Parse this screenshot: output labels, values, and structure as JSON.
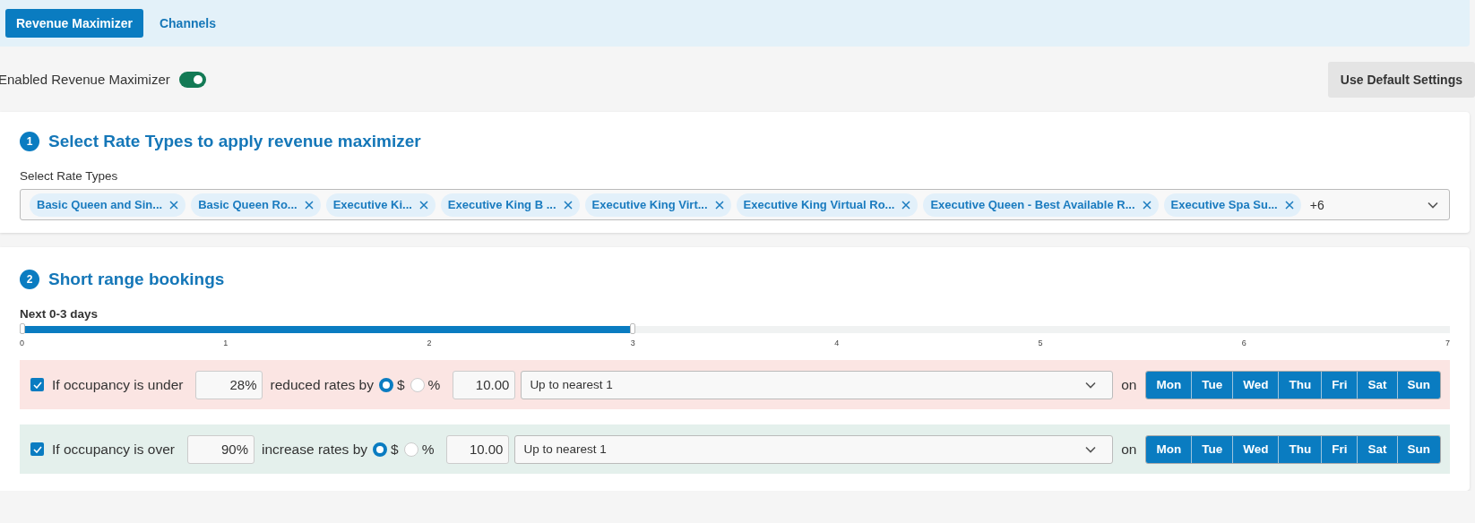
{
  "tabs": [
    {
      "label": "Revenue Maximizer",
      "selected": true
    },
    {
      "label": "Channels",
      "selected": false
    }
  ],
  "enable_toggle": {
    "label": "Enabled Revenue Maximizer",
    "on": true
  },
  "default_button": "Use Default Settings",
  "rate_types": {
    "step": "1",
    "title": "Select Rate Types to apply revenue maximizer",
    "field_label": "Select Rate Types",
    "chips": [
      "Basic Queen and Sin...",
      "Basic Queen Ro...",
      "Executive Ki...",
      "Executive King B ...",
      "Executive King Virt...",
      "Executive King Virtual Ro...",
      "Executive Queen - Best Available R...",
      "Executive Spa Su..."
    ],
    "more": "+6"
  },
  "short_range": {
    "step": "2",
    "title": "Short range bookings",
    "slider_label": "Next 0-3 days",
    "slider": {
      "level": 0.4286,
      "ticks": [
        "0",
        "1",
        "2",
        "3",
        "4",
        "5",
        "6",
        "7"
      ]
    },
    "rules": [
      {
        "kind": "under",
        "checked": true,
        "label": "If occupancy is under",
        "threshold": "28%",
        "action": "reduced rates by",
        "units": [
          {
            "label": "$",
            "selected": true
          },
          {
            "label": "%",
            "selected": false
          }
        ],
        "amount": "10.00",
        "rounding": "Up to nearest 1",
        "on_label": "on",
        "days": [
          {
            "label": "Mon",
            "selected": true
          },
          {
            "label": "Tue",
            "selected": true
          },
          {
            "label": "Wed",
            "selected": true
          },
          {
            "label": "Thu",
            "selected": true
          },
          {
            "label": "Fri",
            "selected": true
          },
          {
            "label": "Sat",
            "selected": true
          },
          {
            "label": "Sun",
            "selected": true
          }
        ]
      },
      {
        "kind": "over",
        "checked": true,
        "label": "If occupancy is over",
        "threshold": "90%",
        "action": "increase rates by",
        "units": [
          {
            "label": "$",
            "selected": true
          },
          {
            "label": "%",
            "selected": false
          }
        ],
        "amount": "10.00",
        "rounding": "Up to nearest 1",
        "on_label": "on",
        "days": [
          {
            "label": "Mon",
            "selected": true
          },
          {
            "label": "Tue",
            "selected": true
          },
          {
            "label": "Wed",
            "selected": true
          },
          {
            "label": "Thu",
            "selected": true
          },
          {
            "label": "Fri",
            "selected": true
          },
          {
            "label": "Sat",
            "selected": true
          },
          {
            "label": "Sun",
            "selected": true
          }
        ]
      }
    ]
  }
}
